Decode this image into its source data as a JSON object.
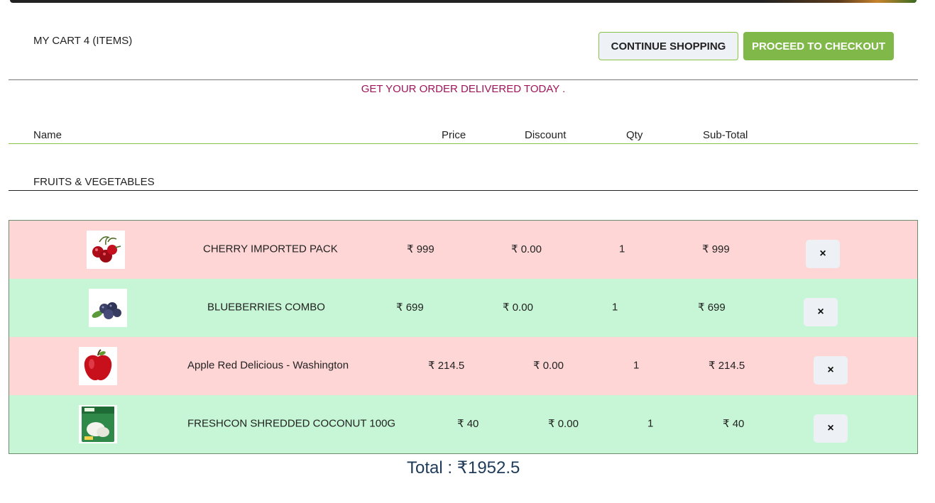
{
  "cart": {
    "title": "MY CART 4 (ITEMS)",
    "continue_label": "CONTINUE SHOPPING",
    "checkout_label": "PROCEED TO CHECKOUT",
    "delivery_message": "GET YOUR ORDER DELIVERED TODAY ."
  },
  "columns": {
    "name": "Name",
    "price": "Price",
    "discount": "Discount",
    "qty": "Qty",
    "subtotal": "Sub-Total"
  },
  "category": "FRUITS & VEGETABLES",
  "items": [
    {
      "name": "CHERRY IMPORTED PACK",
      "price": "₹ 999",
      "discount": "₹ 0.00",
      "qty": "1",
      "subtotal": "₹ 999",
      "remove": "×",
      "image": "cherry-image"
    },
    {
      "name": "BLUEBERRIES COMBO",
      "price": "₹ 699",
      "discount": "₹ 0.00",
      "qty": "1",
      "subtotal": "₹ 699",
      "remove": "×",
      "image": "blueberries-image"
    },
    {
      "name": "Apple Red Delicious - Washington",
      "price": "₹ 214.5",
      "discount": "₹ 0.00",
      "qty": "1",
      "subtotal": "₹ 214.5",
      "remove": "×",
      "image": "apple-image"
    },
    {
      "name": "FRESHCON SHREDDED COCONUT 100G",
      "price": "₹ 40",
      "discount": "₹ 0.00",
      "qty": "1",
      "subtotal": "₹ 40",
      "remove": "×",
      "image": "coconut-pack-image"
    }
  ],
  "total": "Total : ₹1952.5",
  "colors": {
    "checkout": "#80b94a",
    "delivery_text": "#a0155a",
    "row_pink": "#ffd6d6",
    "row_green": "#c6f6d5",
    "total_text": "#1f3b5a"
  }
}
